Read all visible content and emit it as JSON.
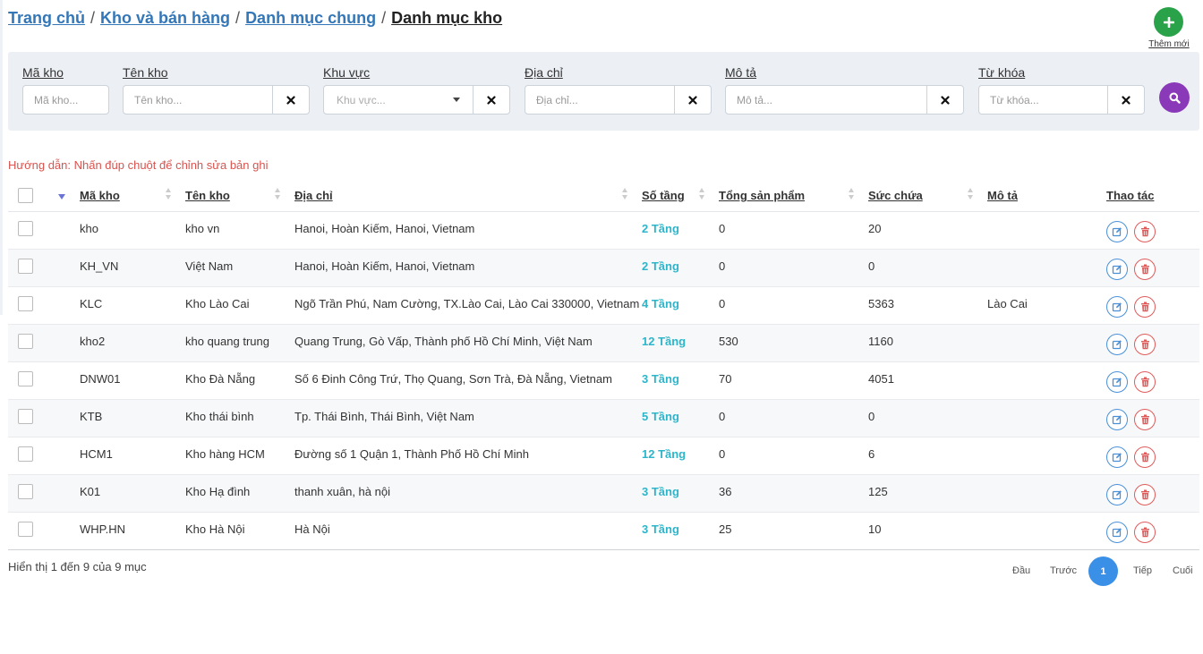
{
  "breadcrumb": [
    {
      "label": "Trang chủ"
    },
    {
      "label": "Kho và bán hàng"
    },
    {
      "label": "Danh mục chung"
    }
  ],
  "breadcrumb_current": "Danh mục kho",
  "breadcrumb_separator": "/",
  "add_new_label": "Thêm mới",
  "filters": {
    "ma_kho": {
      "label": "Mã kho",
      "placeholder": "Mã kho..."
    },
    "ten_kho": {
      "label": "Tên kho",
      "placeholder": "Tên kho..."
    },
    "khu_vuc": {
      "label": "Khu vực",
      "placeholder": "Khu vực..."
    },
    "dia_chi": {
      "label": "Địa chỉ",
      "placeholder": "Địa chỉ..."
    },
    "mo_ta": {
      "label": "Mô tả",
      "placeholder": "Mô tả..."
    },
    "tu_khoa": {
      "label": "Từ khóa",
      "placeholder": "Từ khóa..."
    }
  },
  "hint": "Hướng dẫn: Nhấn đúp chuột để chỉnh sửa bản ghi",
  "table": {
    "columns": {
      "ma_kho": "Mã kho",
      "ten_kho": "Tên kho",
      "dia_chi": "Địa chỉ",
      "so_tang": "Số tầng",
      "tong_san_pham": "Tổng sản phẩm",
      "suc_chua": "Sức chứa",
      "mo_ta": "Mô tả",
      "thao_tac": "Thao tác"
    },
    "rows": [
      {
        "ma_kho": "kho",
        "ten_kho": "kho vn",
        "dia_chi": "Hanoi, Hoàn Kiếm, Hanoi, Vietnam",
        "so_tang": "2 Tầng",
        "tong_san_pham": "0",
        "suc_chua": "20",
        "mo_ta": ""
      },
      {
        "ma_kho": "KH_VN",
        "ten_kho": "Việt Nam",
        "dia_chi": "Hanoi, Hoàn Kiếm, Hanoi, Vietnam",
        "so_tang": "2 Tầng",
        "tong_san_pham": "0",
        "suc_chua": "0",
        "mo_ta": ""
      },
      {
        "ma_kho": "KLC",
        "ten_kho": "Kho Lào Cai",
        "dia_chi": "Ngõ Trần Phú, Nam Cường, TX.Lào Cai, Lào Cai 330000, Vietnam",
        "so_tang": "4 Tầng",
        "tong_san_pham": "0",
        "suc_chua": "5363",
        "mo_ta": "Lào Cai"
      },
      {
        "ma_kho": "kho2",
        "ten_kho": "kho quang trung",
        "dia_chi": "Quang Trung, Gò Vấp, Thành phố Hồ Chí Minh, Việt Nam",
        "so_tang": "12 Tầng",
        "tong_san_pham": "530",
        "suc_chua": "1160",
        "mo_ta": ""
      },
      {
        "ma_kho": "DNW01",
        "ten_kho": "Kho Đà Nẵng",
        "dia_chi": "Số 6 Đinh Công Trứ, Thọ Quang, Sơn Trà, Đà Nẵng, Vietnam",
        "so_tang": "3 Tầng",
        "tong_san_pham": "70",
        "suc_chua": "4051",
        "mo_ta": ""
      },
      {
        "ma_kho": "KTB",
        "ten_kho": "Kho thái bình",
        "dia_chi": "Tp. Thái Bình, Thái Bình, Việt Nam",
        "so_tang": "5 Tầng",
        "tong_san_pham": "0",
        "suc_chua": "0",
        "mo_ta": ""
      },
      {
        "ma_kho": "HCM1",
        "ten_kho": "Kho hàng HCM",
        "dia_chi": "Đường số 1 Quận 1, Thành Phố Hồ Chí Minh",
        "so_tang": "12 Tầng",
        "tong_san_pham": "0",
        "suc_chua": "6",
        "mo_ta": ""
      },
      {
        "ma_kho": "K01",
        "ten_kho": "Kho Hạ đình",
        "dia_chi": "thanh xuân, hà nội",
        "so_tang": "3 Tầng",
        "tong_san_pham": "36",
        "suc_chua": "125",
        "mo_ta": ""
      },
      {
        "ma_kho": "WHP.HN",
        "ten_kho": "Kho Hà Nội",
        "dia_chi": "Hà Nội",
        "so_tang": "3 Tầng",
        "tong_san_pham": "25",
        "suc_chua": "10",
        "mo_ta": ""
      }
    ]
  },
  "footer": {
    "info": "Hiển thị 1 đến 9 của 9 mục",
    "first": "Đầu",
    "prev": "Trước",
    "current_page": "1",
    "next": "Tiếp",
    "last": "Cuối"
  },
  "colors": {
    "link": "#3477b8",
    "add_button": "#2aa24a",
    "search_button": "#8a3ab9",
    "hint": "#d9534f",
    "floors": "#2eb5c9",
    "page_active": "#3a8fe6",
    "edit": "#4a90d9",
    "delete": "#e05a5a"
  },
  "icons": {
    "add": "plus-icon",
    "clear": "close-icon",
    "search": "search-icon",
    "edit": "edit-icon",
    "delete": "trash-icon",
    "dropdown": "caret-down-icon"
  }
}
